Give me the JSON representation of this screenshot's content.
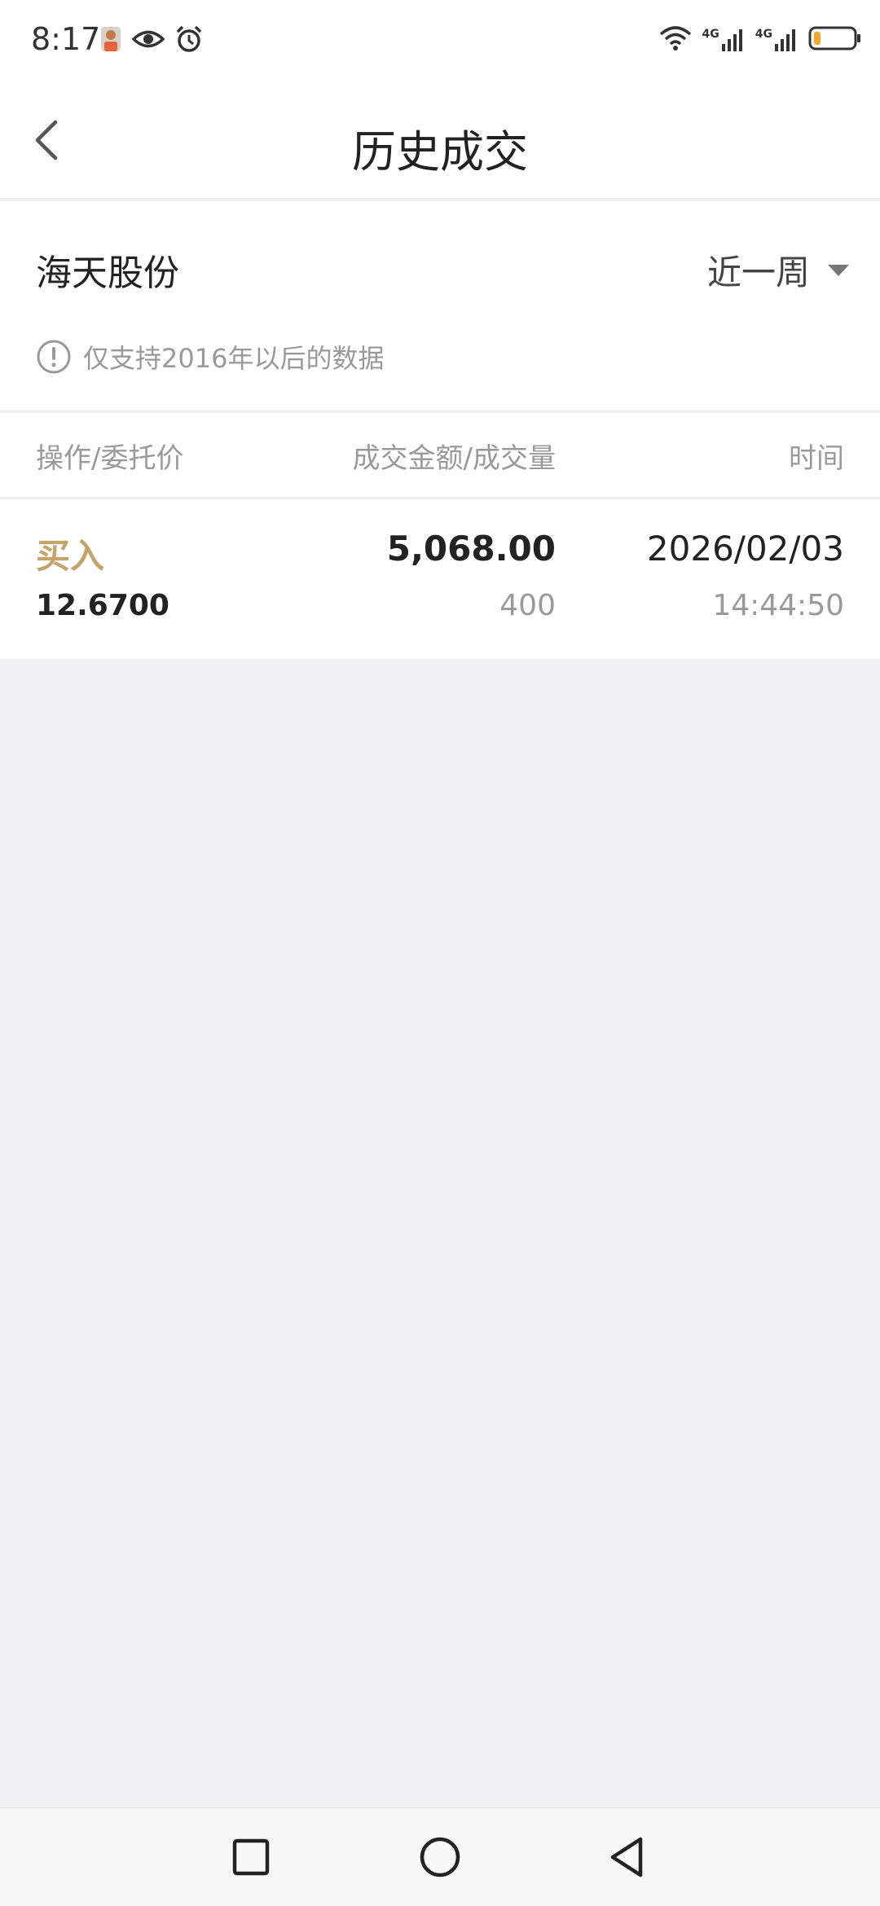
{
  "status_bar": {
    "time": "8:17",
    "left_icons": [
      "avatar-icon",
      "eye-icon",
      "alarm-icon"
    ],
    "right_icons": [
      "wifi-icon",
      "signal-4g-icon",
      "signal-4g-icon",
      "battery-icon"
    ],
    "network_label_1": "4G",
    "network_label_2": "4G",
    "battery_color": "#f5a623"
  },
  "header": {
    "title": "历史成交",
    "back_icon": "chevron-left-icon"
  },
  "stock": {
    "name": "海天股份",
    "period": "近一周",
    "note": "仅支持2016年以后的数据"
  },
  "table": {
    "columns": {
      "operation": "操作/委托价",
      "amount": "成交金额/成交量",
      "time": "时间"
    },
    "rows": [
      {
        "action": "买入",
        "price": "12.6700",
        "amount": "5,068.00",
        "volume": "400",
        "date": "2026/02/03",
        "time": "14:44:50"
      }
    ]
  },
  "colors": {
    "accent_buy": "#c4a46a",
    "background": "#f0f0f2",
    "text_primary": "#222222",
    "text_secondary": "#999999"
  },
  "system_nav": {
    "buttons": [
      "recents-square-icon",
      "home-circle-icon",
      "back-triangle-icon"
    ]
  }
}
